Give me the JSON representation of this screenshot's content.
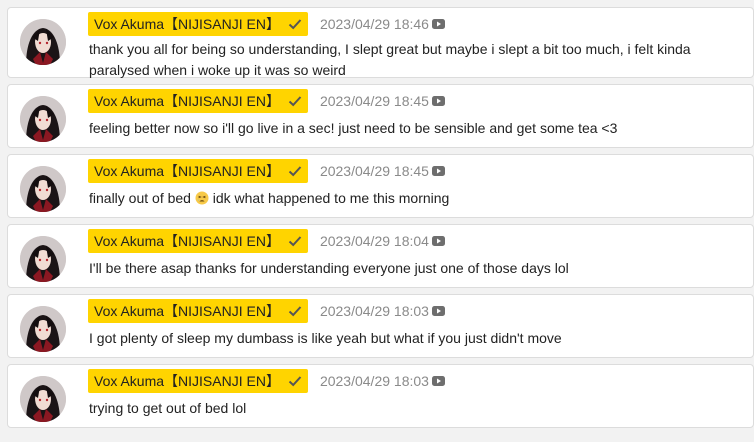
{
  "posts": [
    {
      "author": "Vox Akuma【NIJISANJI EN】",
      "timestamp": "2023/04/29 18:46",
      "message": "thank you all for being so understanding, I slept great but maybe i slept a bit too much, i felt kinda paralysed when i woke up it was so weird"
    },
    {
      "author": "Vox Akuma【NIJISANJI EN】",
      "timestamp": "2023/04/29 18:45",
      "message": "feeling better now so i'll go live in a sec! just need to be sensible and get some tea <3"
    },
    {
      "author": "Vox Akuma【NIJISANJI EN】",
      "timestamp": "2023/04/29 18:45",
      "message_before_emoji": "finally out of bed ",
      "emoji": "tired-face-emoji",
      "message_after_emoji": " idk what happened to me this morning"
    },
    {
      "author": "Vox Akuma【NIJISANJI EN】",
      "timestamp": "2023/04/29 18:04",
      "message": "I'll be there asap thanks for understanding everyone just one of those days lol"
    },
    {
      "author": "Vox Akuma【NIJISANJI EN】",
      "timestamp": "2023/04/29 18:03",
      "message": "I got plenty of sleep my dumbass is like yeah but what if you just didn't move"
    },
    {
      "author": "Vox Akuma【NIJISANJI EN】",
      "timestamp": "2023/04/29 18:03",
      "message": "trying to get out of bed lol"
    }
  ],
  "icons": {
    "verified": "check-icon",
    "source": "youtube-icon"
  },
  "colors": {
    "name_chip": "#ffd400",
    "timestamp": "#8a8a8a",
    "text": "#222222"
  }
}
